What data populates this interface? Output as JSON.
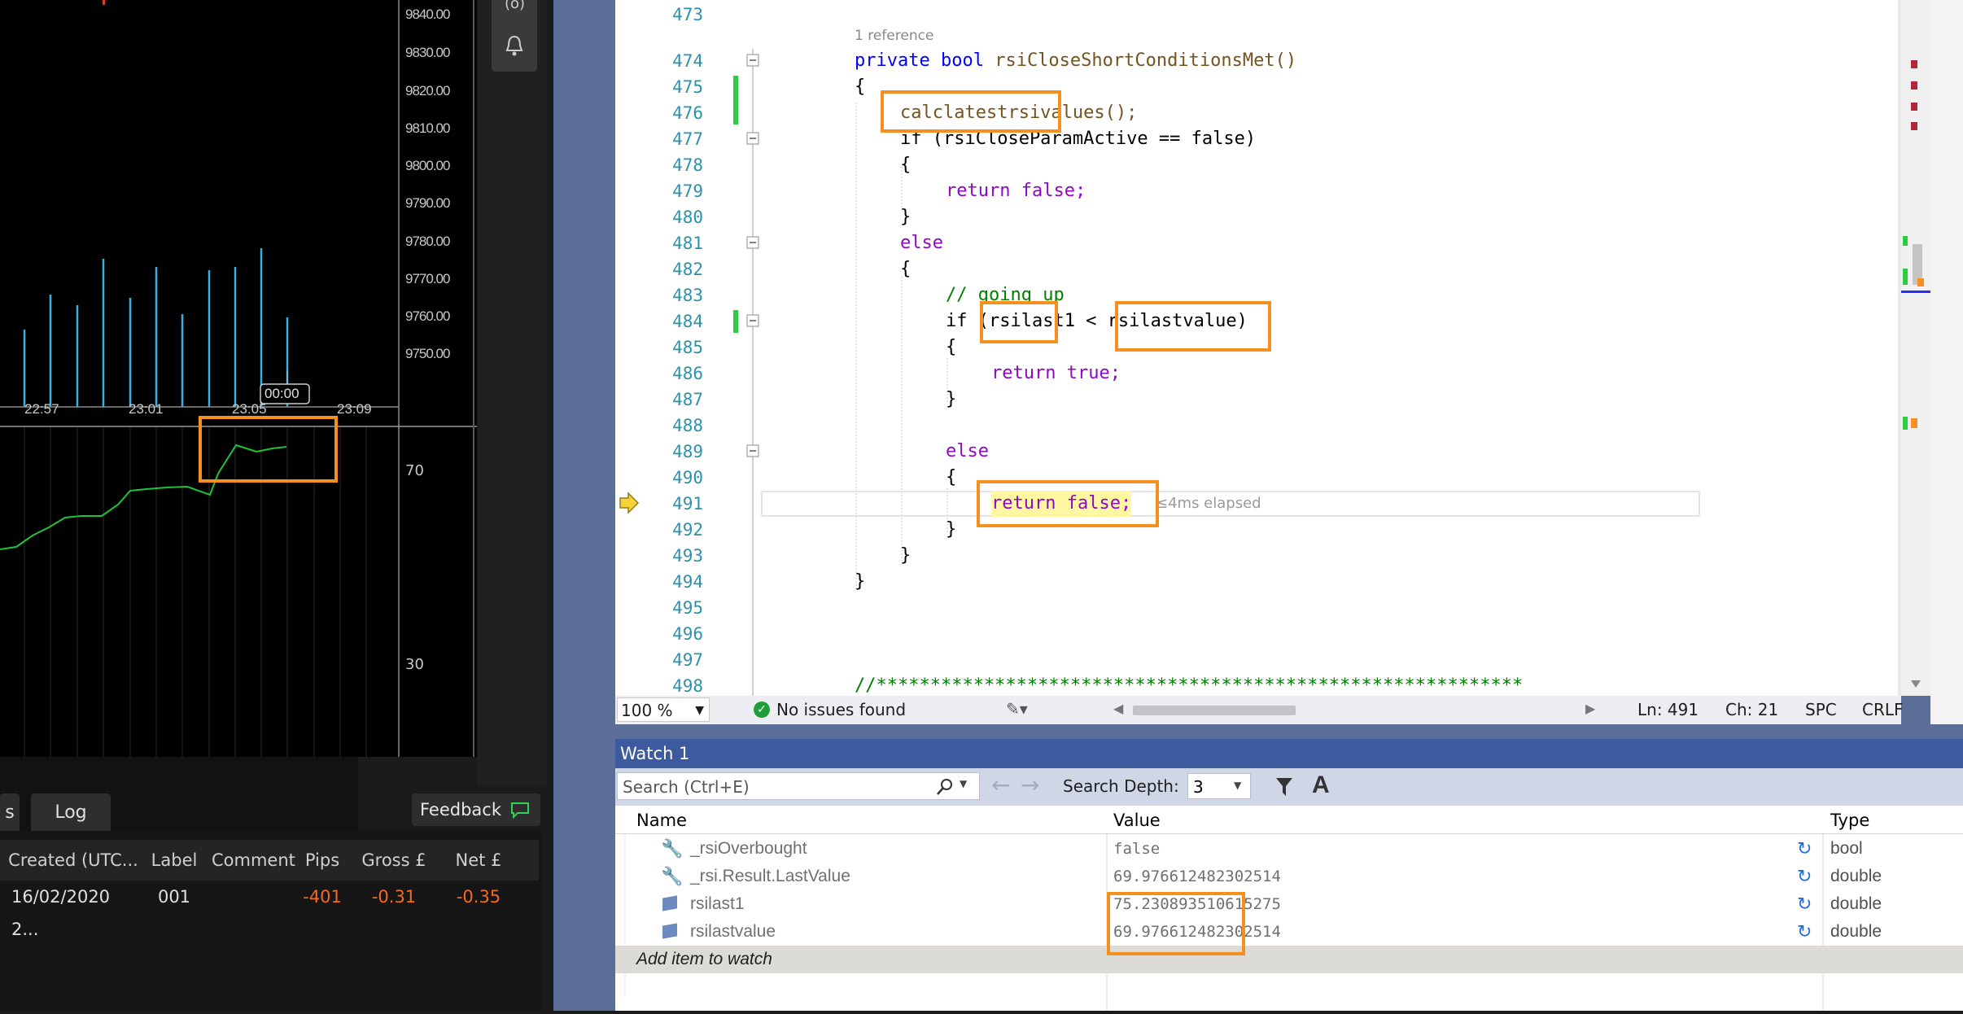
{
  "chart": {
    "price_ticks": [
      "9840.00",
      "9830.00",
      "9820.00",
      "9810.00",
      "9800.00",
      "9790.00",
      "9780.00",
      "9770.00",
      "9760.00",
      "9750.00"
    ],
    "time_ticks": [
      "22:57",
      "23:01",
      "23:05",
      "23:09"
    ],
    "cursor_label": "00:00",
    "rsi_ticks": [
      "70",
      "30"
    ],
    "top_icon_label": "(o)"
  },
  "bottom_panel": {
    "tabs": [
      "s",
      "Log"
    ],
    "feedback_label": "Feedback",
    "columns": [
      "Created (UTC...",
      "Label",
      "Comment",
      "Pips",
      "Gross £",
      "Net £"
    ],
    "row": {
      "created": "16/02/2020 2...",
      "label": "001",
      "comment": "",
      "pips": "-401",
      "gross": "-0.31",
      "net": "-0.35"
    }
  },
  "editor": {
    "codelens": "1 reference",
    "lines": [
      {
        "n": "473",
        "code": ""
      },
      {
        "n": "474",
        "code": "private bool rsiCloseShortConditionsMet()"
      },
      {
        "n": "475",
        "code": "{"
      },
      {
        "n": "476",
        "code": "calclatestrsivalues();"
      },
      {
        "n": "477",
        "code": "if (rsiCloseParamActive == false)"
      },
      {
        "n": "478",
        "code": "{"
      },
      {
        "n": "479",
        "code": "return false;"
      },
      {
        "n": "480",
        "code": "}"
      },
      {
        "n": "481",
        "code": "else"
      },
      {
        "n": "482",
        "code": "{"
      },
      {
        "n": "483",
        "code": "// going up"
      },
      {
        "n": "484",
        "code": "if (rsilast1 < rsilastvalue)"
      },
      {
        "n": "485",
        "code": "{"
      },
      {
        "n": "486",
        "code": "return true;"
      },
      {
        "n": "487",
        "code": "}"
      },
      {
        "n": "488",
        "code": ""
      },
      {
        "n": "489",
        "code": "else"
      },
      {
        "n": "490",
        "code": "{"
      },
      {
        "n": "491",
        "code": "return false;"
      },
      {
        "n": "492",
        "code": "}"
      },
      {
        "n": "493",
        "code": "}"
      },
      {
        "n": "494",
        "code": "}"
      },
      {
        "n": "495",
        "code": ""
      },
      {
        "n": "496",
        "code": ""
      },
      {
        "n": "497",
        "code": ""
      },
      {
        "n": "498",
        "code": "//************************************************************"
      }
    ],
    "elapsed": "≤4ms elapsed"
  },
  "status": {
    "zoom": "100 %",
    "issues": "No issues found",
    "ln": "Ln: 491",
    "ch": "Ch: 21",
    "spc": "SPC",
    "crlf": "CRLF"
  },
  "watch": {
    "title": "Watch 1",
    "search_placeholder": "Search (Ctrl+E)",
    "depth_label": "Search Depth:",
    "depth_value": "3",
    "columns": [
      "Name",
      "Value",
      "Type"
    ],
    "rows": [
      {
        "name": "_rsiOverbought",
        "value": "false",
        "type": "bool"
      },
      {
        "name": "_rsi.Result.LastValue",
        "value": "69.976612482302514",
        "type": "double"
      },
      {
        "name": "rsilast1",
        "value": "75.230893510615275",
        "type": "double"
      },
      {
        "name": "rsilastvalue",
        "value": "69.976612482302514",
        "type": "double"
      }
    ],
    "add_item": "Add item to watch"
  },
  "colors": {
    "highlight": "#f5901e",
    "keyword": "#0000ff",
    "control": "#8f08c4",
    "comment": "#008000",
    "line_number": "#2b91af"
  }
}
